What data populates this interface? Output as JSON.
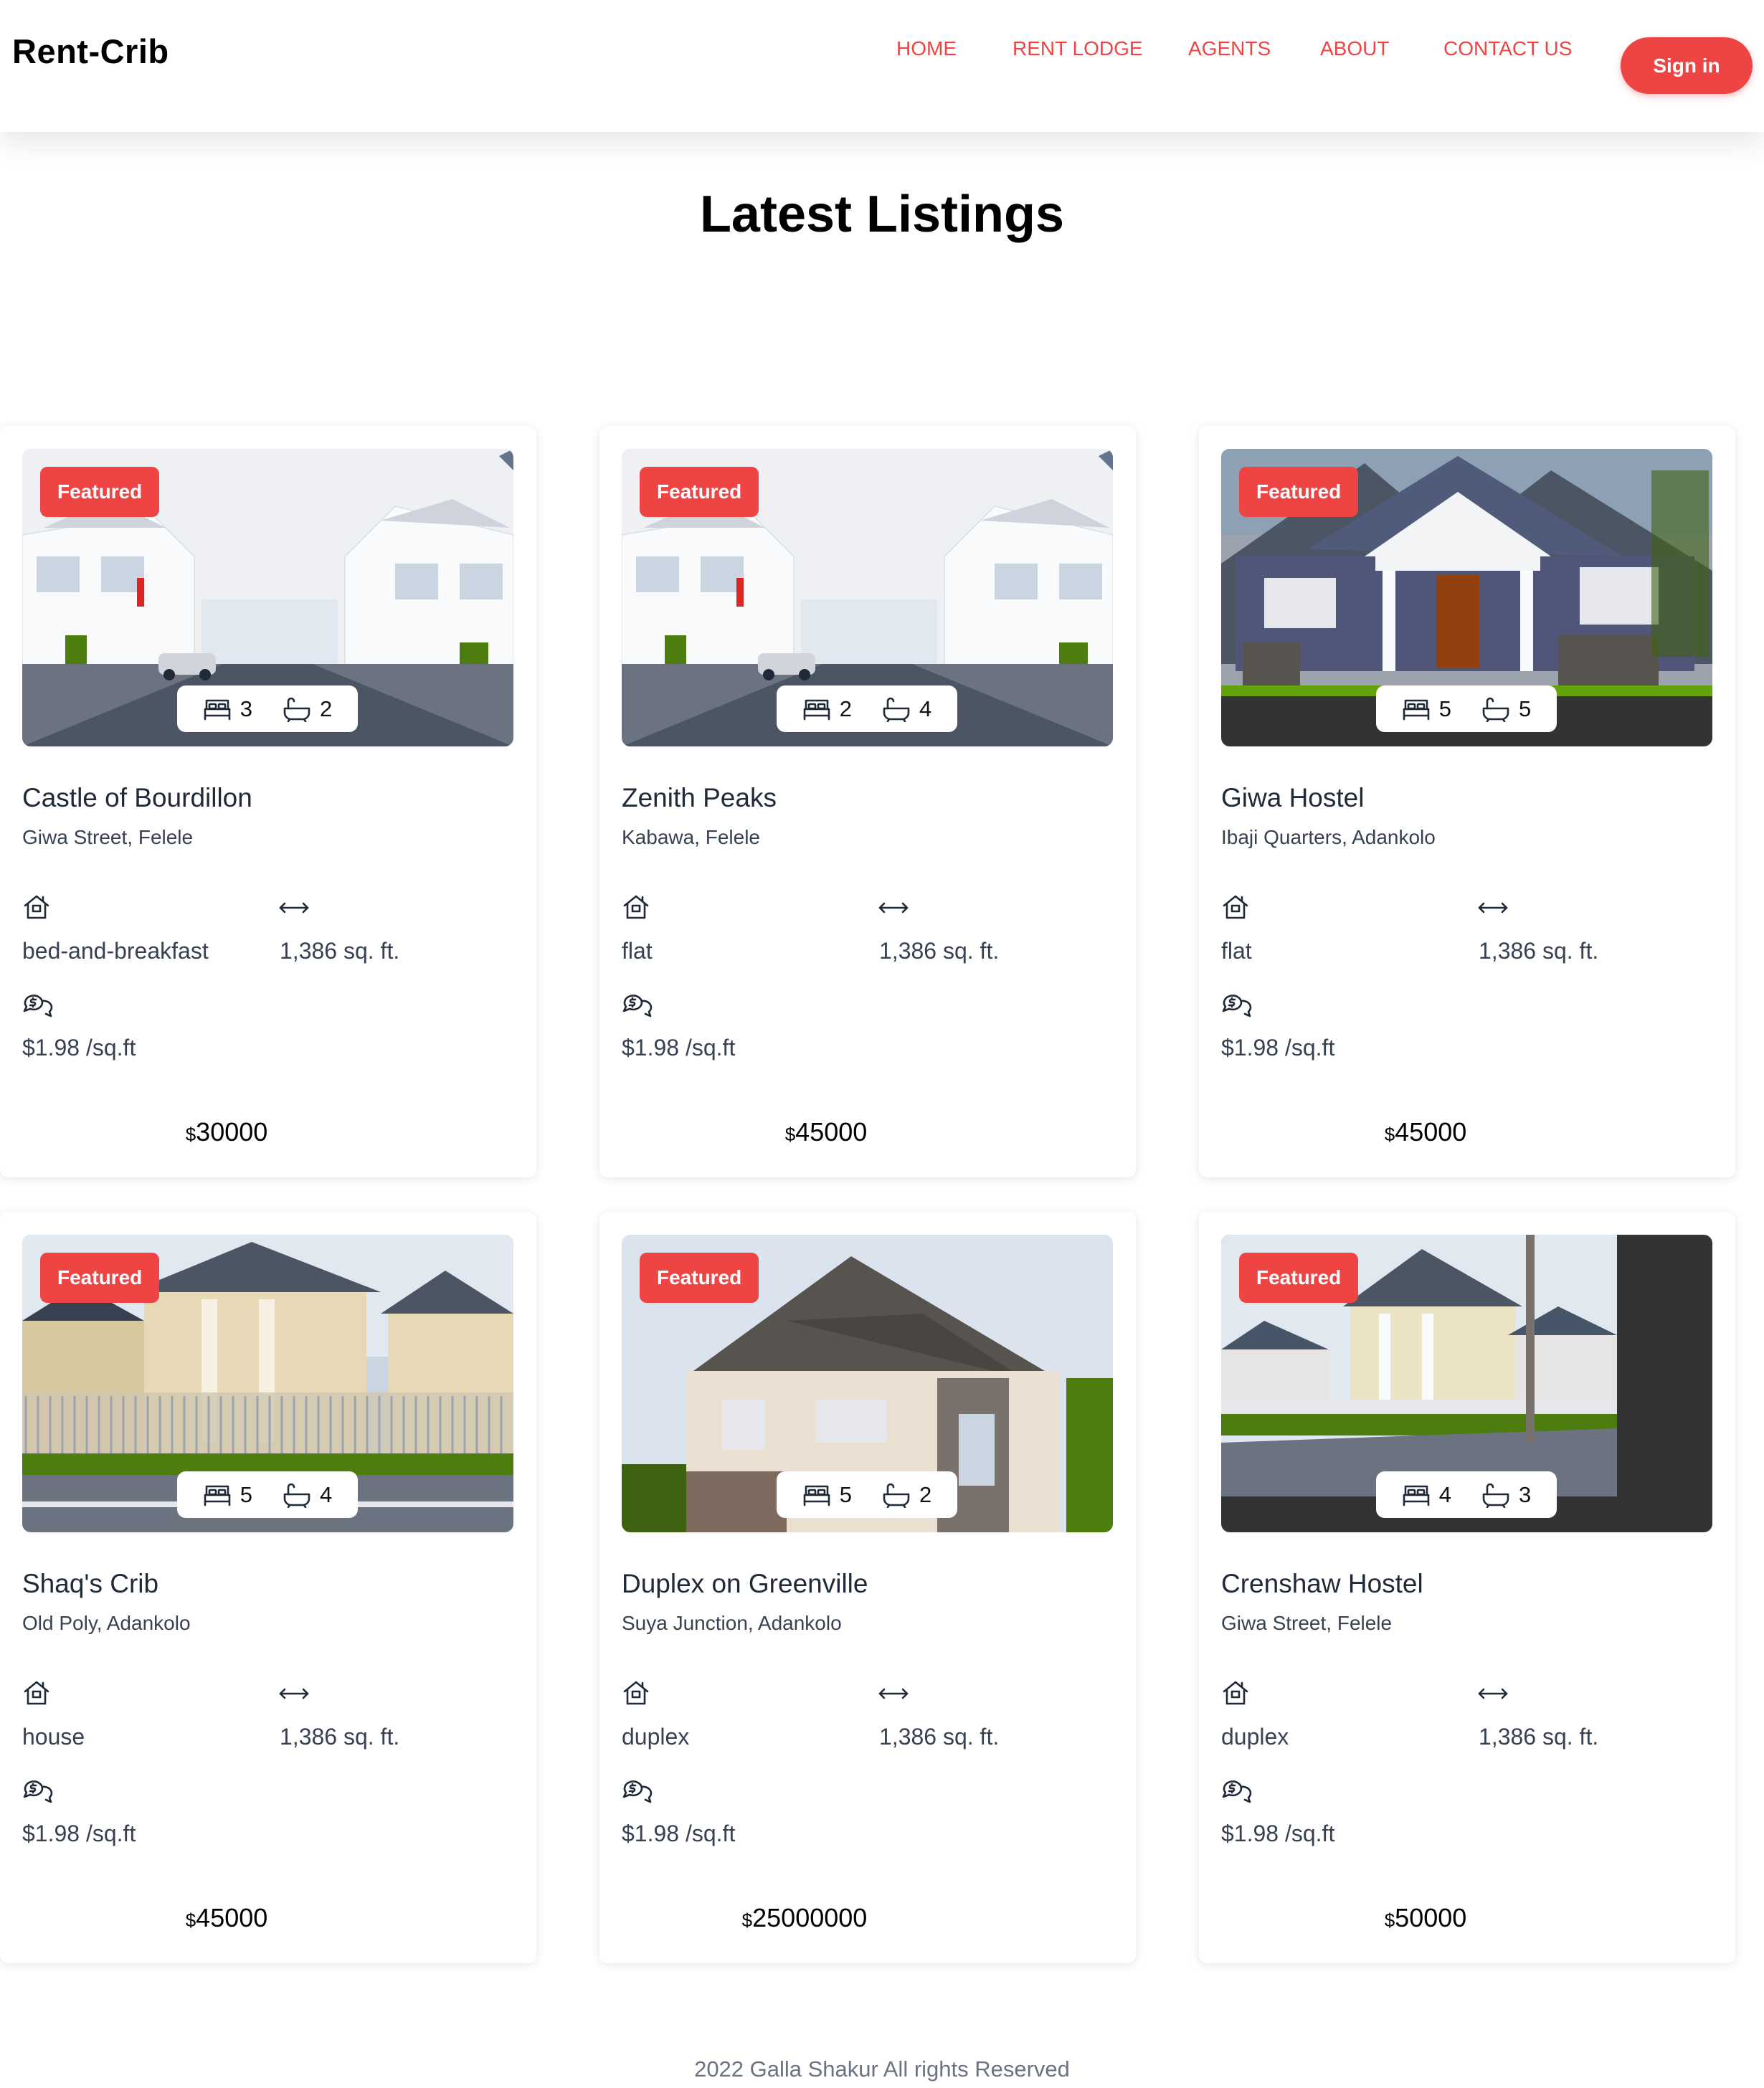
{
  "header": {
    "brand": "Rent-Crib",
    "nav": [
      {
        "label": "HOME"
      },
      {
        "label": "RENT LODGE"
      },
      {
        "label": "AGENTS"
      },
      {
        "label": "ABOUT"
      },
      {
        "label": "CONTACT US"
      }
    ],
    "signin_label": "Sign in"
  },
  "main": {
    "title": "Latest Listings"
  },
  "listings": [
    {
      "badge": "Featured",
      "beds": "3",
      "baths": "2",
      "name": "Castle of Bourdillon",
      "location": "Giwa Street, Felele",
      "type": "bed-and-breakfast",
      "area": "1,386 sq. ft.",
      "rate": "$1.98 /sq.ft",
      "currency": "$",
      "price": "30000",
      "image": "white-villas-street"
    },
    {
      "badge": "Featured",
      "beds": "2",
      "baths": "4",
      "name": "Zenith Peaks",
      "location": "Kabawa, Felele",
      "type": "flat",
      "area": "1,386 sq. ft.",
      "rate": "$1.98 /sq.ft",
      "currency": "$",
      "price": "45000",
      "image": "white-villas-street"
    },
    {
      "badge": "Featured",
      "beds": "5",
      "baths": "5",
      "name": "Giwa Hostel",
      "location": "Ibaji Quarters, Adankolo",
      "type": "flat",
      "area": "1,386 sq. ft.",
      "rate": "$1.98 /sq.ft",
      "currency": "$",
      "price": "45000",
      "image": "blue-craftsman-house"
    },
    {
      "badge": "Featured",
      "beds": "5",
      "baths": "4",
      "name": "Shaq's Crib",
      "location": "Old Poly, Adankolo",
      "type": "house",
      "area": "1,386 sq. ft.",
      "rate": "$1.98 /sq.ft",
      "currency": "$",
      "price": "45000",
      "image": "beige-gated-house"
    },
    {
      "badge": "Featured",
      "beds": "5",
      "baths": "2",
      "name": "Duplex on Greenville",
      "location": "Suya Junction, Adankolo",
      "type": "duplex",
      "area": "1,386 sq. ft.",
      "rate": "$1.98 /sq.ft",
      "currency": "$",
      "price": "25000000",
      "image": "stone-duplex"
    },
    {
      "badge": "Featured",
      "beds": "4",
      "baths": "3",
      "name": "Crenshaw Hostel",
      "location": "Giwa Street, Felele",
      "type": "duplex",
      "area": "1,386 sq. ft.",
      "rate": "$1.98 /sq.ft",
      "currency": "$",
      "price": "50000",
      "image": "estate-street-houses"
    }
  ],
  "footer": {
    "text": "2022 Galla Shakur All rights Reserved"
  },
  "colors": {
    "accent": "#ef4444",
    "text": "#111827",
    "muted": "#6b7280"
  },
  "icons": {
    "bed": "bed-icon",
    "bath": "bathtub-icon",
    "property_type": "house-icon",
    "area": "arrows-horizontal-icon",
    "rate": "chat-dollar-icon"
  }
}
